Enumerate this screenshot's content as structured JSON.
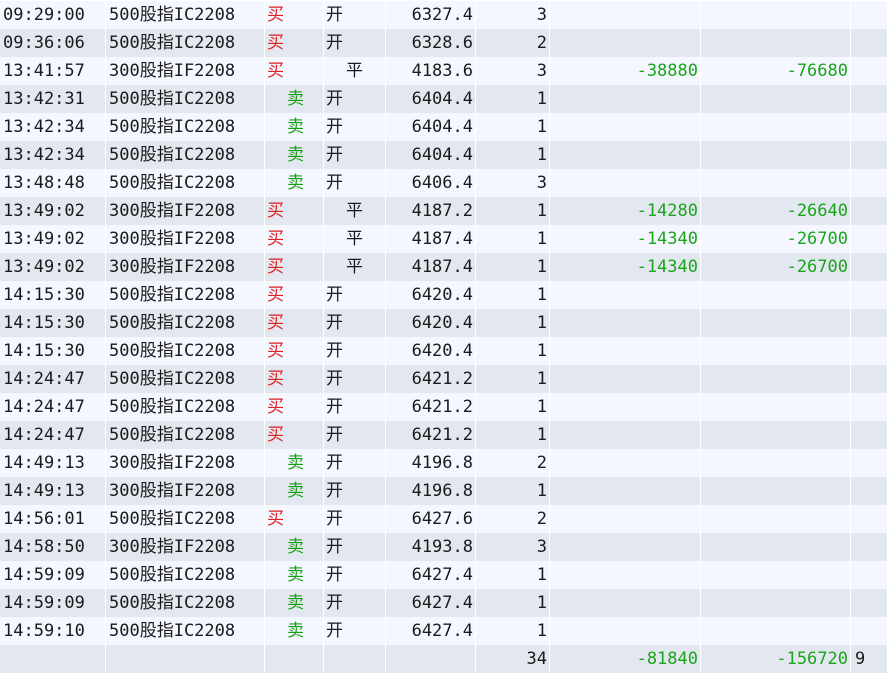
{
  "colors": {
    "buy": "#e02020",
    "sell": "#16a016",
    "loss": "#1aa51a",
    "row_light": "#f4f7ff",
    "row_dark": "#e3e7ef"
  },
  "top_row": {
    "time": "09:29:00",
    "instrument": "500股指IC2208",
    "direction": "买",
    "direction_type": "buy",
    "open_close": "开",
    "oc_type": "open",
    "price": "6327.4",
    "qty": "3",
    "pl1": "",
    "pl2": ""
  },
  "rows": [
    {
      "time": "09:36:06",
      "instrument": "500股指IC2208",
      "direction": "买",
      "direction_type": "buy",
      "open_close": "开",
      "oc_type": "open",
      "price": "6328.6",
      "qty": "2",
      "pl1": "",
      "pl2": ""
    },
    {
      "time": "13:41:57",
      "instrument": "300股指IF2208",
      "direction": "买",
      "direction_type": "buy",
      "open_close": "平",
      "oc_type": "close",
      "price": "4183.6",
      "qty": "3",
      "pl1": "-38880",
      "pl2": "-76680"
    },
    {
      "time": "13:42:31",
      "instrument": "500股指IC2208",
      "direction": "卖",
      "direction_type": "sell",
      "open_close": "开",
      "oc_type": "open",
      "price": "6404.4",
      "qty": "1",
      "pl1": "",
      "pl2": ""
    },
    {
      "time": "13:42:34",
      "instrument": "500股指IC2208",
      "direction": "卖",
      "direction_type": "sell",
      "open_close": "开",
      "oc_type": "open",
      "price": "6404.4",
      "qty": "1",
      "pl1": "",
      "pl2": ""
    },
    {
      "time": "13:42:34",
      "instrument": "500股指IC2208",
      "direction": "卖",
      "direction_type": "sell",
      "open_close": "开",
      "oc_type": "open",
      "price": "6404.4",
      "qty": "1",
      "pl1": "",
      "pl2": ""
    },
    {
      "time": "13:48:48",
      "instrument": "500股指IC2208",
      "direction": "卖",
      "direction_type": "sell",
      "open_close": "开",
      "oc_type": "open",
      "price": "6406.4",
      "qty": "3",
      "pl1": "",
      "pl2": ""
    },
    {
      "time": "13:49:02",
      "instrument": "300股指IF2208",
      "direction": "买",
      "direction_type": "buy",
      "open_close": "平",
      "oc_type": "close",
      "price": "4187.2",
      "qty": "1",
      "pl1": "-14280",
      "pl2": "-26640"
    },
    {
      "time": "13:49:02",
      "instrument": "300股指IF2208",
      "direction": "买",
      "direction_type": "buy",
      "open_close": "平",
      "oc_type": "close",
      "price": "4187.4",
      "qty": "1",
      "pl1": "-14340",
      "pl2": "-26700"
    },
    {
      "time": "13:49:02",
      "instrument": "300股指IF2208",
      "direction": "买",
      "direction_type": "buy",
      "open_close": "平",
      "oc_type": "close",
      "price": "4187.4",
      "qty": "1",
      "pl1": "-14340",
      "pl2": "-26700"
    },
    {
      "time": "14:15:30",
      "instrument": "500股指IC2208",
      "direction": "买",
      "direction_type": "buy",
      "open_close": "开",
      "oc_type": "open",
      "price": "6420.4",
      "qty": "1",
      "pl1": "",
      "pl2": ""
    },
    {
      "time": "14:15:30",
      "instrument": "500股指IC2208",
      "direction": "买",
      "direction_type": "buy",
      "open_close": "开",
      "oc_type": "open",
      "price": "6420.4",
      "qty": "1",
      "pl1": "",
      "pl2": ""
    },
    {
      "time": "14:15:30",
      "instrument": "500股指IC2208",
      "direction": "买",
      "direction_type": "buy",
      "open_close": "开",
      "oc_type": "open",
      "price": "6420.4",
      "qty": "1",
      "pl1": "",
      "pl2": ""
    },
    {
      "time": "14:24:47",
      "instrument": "500股指IC2208",
      "direction": "买",
      "direction_type": "buy",
      "open_close": "开",
      "oc_type": "open",
      "price": "6421.2",
      "qty": "1",
      "pl1": "",
      "pl2": ""
    },
    {
      "time": "14:24:47",
      "instrument": "500股指IC2208",
      "direction": "买",
      "direction_type": "buy",
      "open_close": "开",
      "oc_type": "open",
      "price": "6421.2",
      "qty": "1",
      "pl1": "",
      "pl2": ""
    },
    {
      "time": "14:24:47",
      "instrument": "500股指IC2208",
      "direction": "买",
      "direction_type": "buy",
      "open_close": "开",
      "oc_type": "open",
      "price": "6421.2",
      "qty": "1",
      "pl1": "",
      "pl2": ""
    },
    {
      "time": "14:49:13",
      "instrument": "300股指IF2208",
      "direction": "卖",
      "direction_type": "sell",
      "open_close": "开",
      "oc_type": "open",
      "price": "4196.8",
      "qty": "2",
      "pl1": "",
      "pl2": ""
    },
    {
      "time": "14:49:13",
      "instrument": "300股指IF2208",
      "direction": "卖",
      "direction_type": "sell",
      "open_close": "开",
      "oc_type": "open",
      "price": "4196.8",
      "qty": "1",
      "pl1": "",
      "pl2": ""
    },
    {
      "time": "14:56:01",
      "instrument": "500股指IC2208",
      "direction": "买",
      "direction_type": "buy",
      "open_close": "开",
      "oc_type": "open",
      "price": "6427.6",
      "qty": "2",
      "pl1": "",
      "pl2": ""
    },
    {
      "time": "14:58:50",
      "instrument": "300股指IF2208",
      "direction": "卖",
      "direction_type": "sell",
      "open_close": "开",
      "oc_type": "open",
      "price": "4193.8",
      "qty": "3",
      "pl1": "",
      "pl2": ""
    },
    {
      "time": "14:59:09",
      "instrument": "500股指IC2208",
      "direction": "卖",
      "direction_type": "sell",
      "open_close": "开",
      "oc_type": "open",
      "price": "6427.4",
      "qty": "1",
      "pl1": "",
      "pl2": ""
    },
    {
      "time": "14:59:09",
      "instrument": "500股指IC2208",
      "direction": "卖",
      "direction_type": "sell",
      "open_close": "开",
      "oc_type": "open",
      "price": "6427.4",
      "qty": "1",
      "pl1": "",
      "pl2": ""
    },
    {
      "time": "14:59:10",
      "instrument": "500股指IC2208",
      "direction": "卖",
      "direction_type": "sell",
      "open_close": "开",
      "oc_type": "open",
      "price": "6427.4",
      "qty": "1",
      "pl1": "",
      "pl2": ""
    }
  ],
  "summary": {
    "qty": "34",
    "pl1": "-81840",
    "pl2": "-156720",
    "extra": "9"
  }
}
